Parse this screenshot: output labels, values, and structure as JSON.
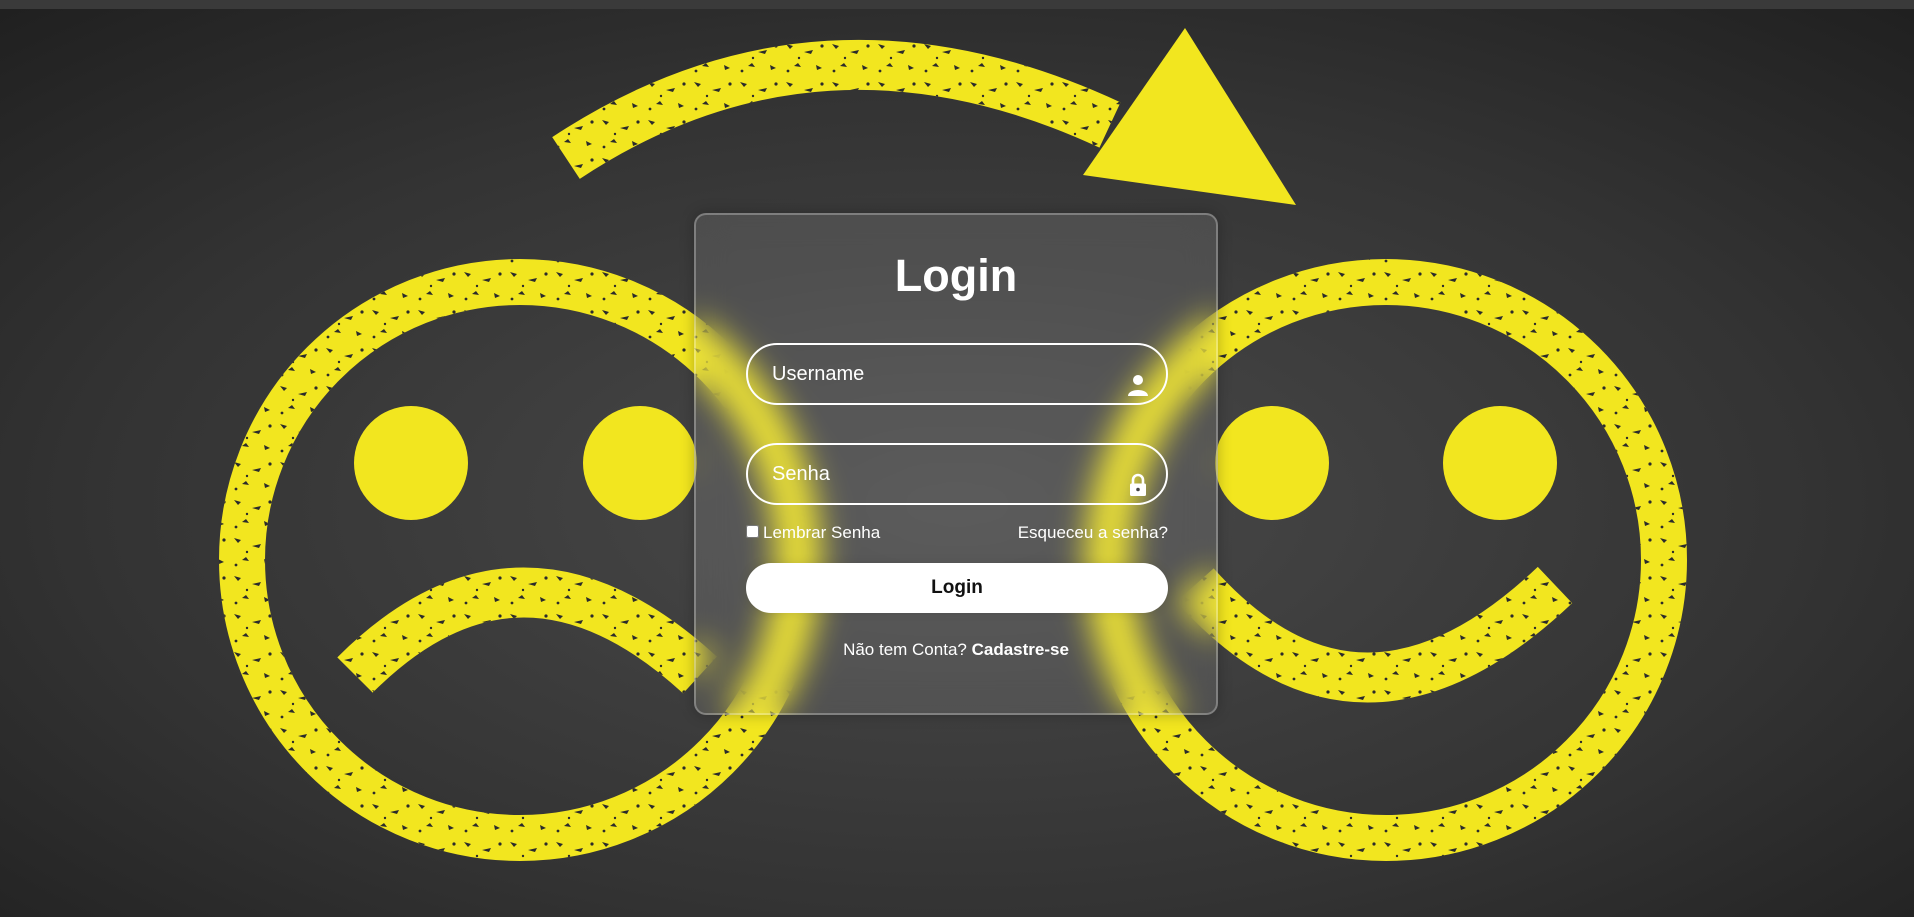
{
  "login": {
    "title": "Login",
    "username_placeholder": "Username",
    "password_placeholder": "Senha",
    "remember_label": "Lembrar Senha",
    "forgot_label": "Esqueceu a senha?",
    "submit_label": "Login",
    "register_prompt": "Não tem Conta?",
    "register_link": "Cadastre-se"
  },
  "icons": {
    "username": "user-icon",
    "password": "lock-icon"
  },
  "colors": {
    "background": "#2b2b2b",
    "accent_yellow": "#f2e61f",
    "text": "#ffffff",
    "button_bg": "#ffffff",
    "button_text": "#111111"
  }
}
